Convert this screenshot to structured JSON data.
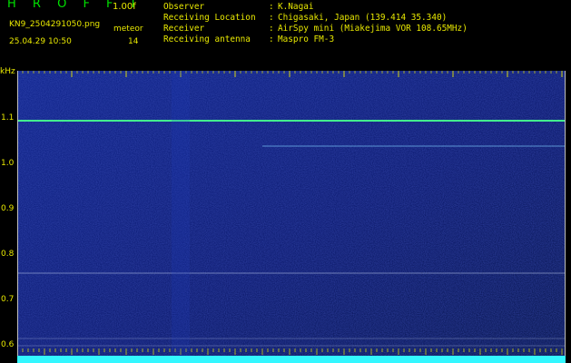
{
  "app": {
    "title": "H R O F F T",
    "version": "1.00f",
    "file_name": "KN9_2504291050.png",
    "timestamp": "25.04.29 10:50",
    "meteor_label": "meteor",
    "meteor_count": "14"
  },
  "info": {
    "rows": [
      {
        "key": "Observer",
        "sep": ":",
        "value": "K.Nagai"
      },
      {
        "key": "Receiving Location",
        "sep": ":",
        "value": "Chigasaki, Japan (139.414 35.340)"
      },
      {
        "key": "Receiver",
        "sep": ":",
        "value": "AirSpy mini (Miakejima VOR 108.65MHz)"
      },
      {
        "key": "Receiving antenna",
        "sep": ":",
        "value": "Maspro FM-3"
      }
    ]
  },
  "axis": {
    "unit": "kHz",
    "x_ticks": [
      "1051",
      "1052",
      "1053",
      "1054",
      "1055",
      "1056",
      "1057",
      "1058",
      "1059",
      "1100"
    ],
    "y_ticks": [
      "1.1",
      "1.0",
      "0.9",
      "0.8",
      "0.7",
      "0.6"
    ]
  },
  "spectrogram": {
    "background_colors": [
      "#031040",
      "#071466",
      "#0d2090"
    ],
    "signal_color": "#46ff8f",
    "cyan_bar_color": "#33f7ff",
    "ticks_color": "#e8e800"
  }
}
